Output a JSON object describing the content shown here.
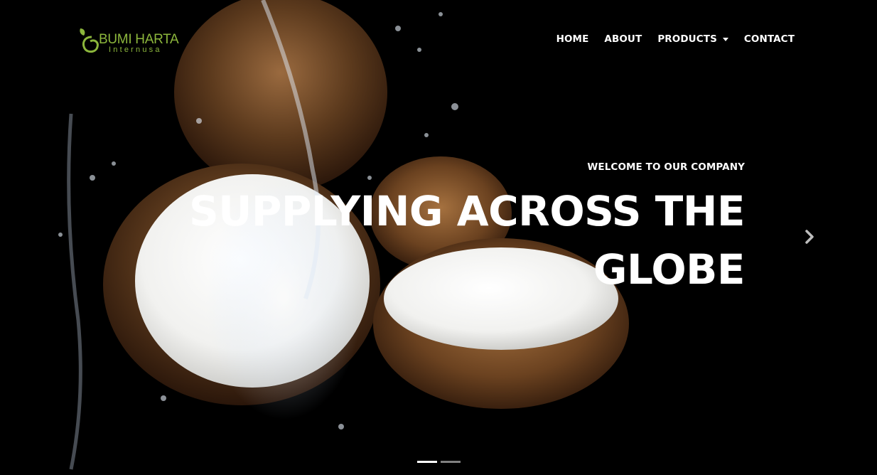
{
  "brand": {
    "name": "BUMI HARTA",
    "tagline": "Internusa",
    "logo_icon": "leaf-swirl-icon",
    "color": "#8cb63c"
  },
  "nav": {
    "items": [
      {
        "label": "HOME"
      },
      {
        "label": "ABOUT"
      },
      {
        "label": "PRODUCTS",
        "has_dropdown": true
      },
      {
        "label": "CONTACT"
      }
    ]
  },
  "hero": {
    "background_image": "coconut halves splashing with water on black background",
    "eyebrow": "WELCOME TO OUR COMPANY",
    "headline_line1": "SUPPLYING ACROSS THE",
    "headline_line2": "GLOBE",
    "next_icon": "chevron-right-icon"
  },
  "carousel": {
    "slide_count": 2,
    "active_index": 0
  }
}
